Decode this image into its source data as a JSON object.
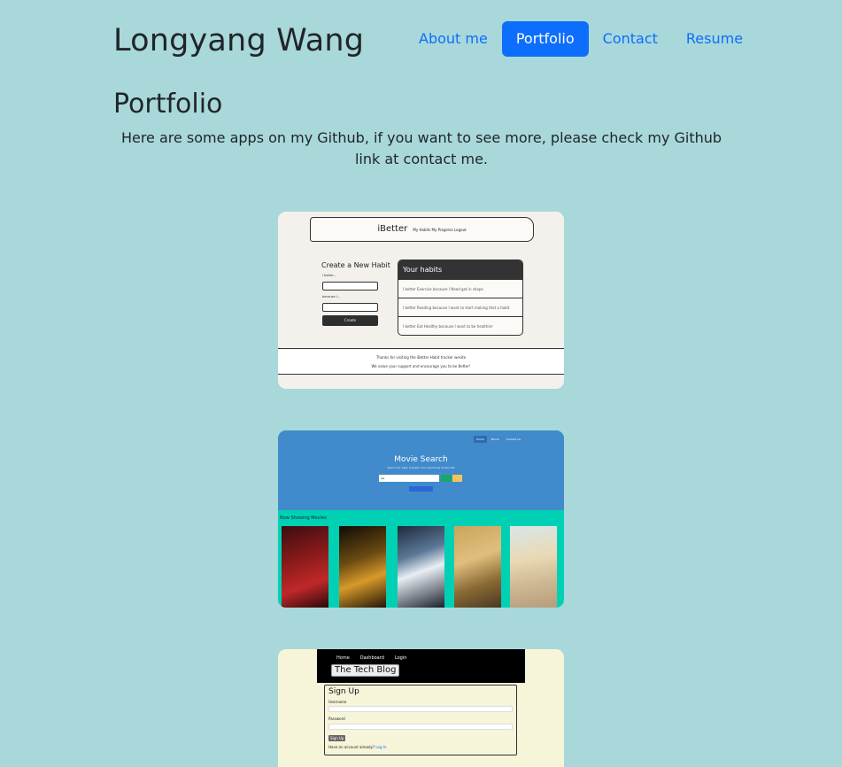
{
  "header": {
    "site_title": "Longyang Wang",
    "nav": [
      {
        "label": "About me",
        "active": false
      },
      {
        "label": "Portfolio",
        "active": true
      },
      {
        "label": "Contact",
        "active": false
      },
      {
        "label": "Resume",
        "active": false
      }
    ]
  },
  "main": {
    "heading": "Portfolio",
    "intro": "Here are some apps on my Github, if you want to see more, please check my Github link at contact me."
  },
  "projects": [
    {
      "name": "iBetter",
      "nav": "My Habits  My Progress  Logout",
      "create_title": "Create a New Habit",
      "label_better": "I better...",
      "label_because": "because I...",
      "create_button": "Create",
      "habits_title": "Your habits",
      "habits": [
        "I better Exercise because I Need get in shape",
        "I better Reading because I want to start making that a habit",
        "I better Eat Healthy because I want to be healthier"
      ],
      "footer_line1": "Thanks for visiting the iBetter Habit tracker wesite",
      "footer_line2": "We value your support and encourage you to be Better!"
    },
    {
      "name": "Movie Search",
      "nav": [
        "Home",
        "Movie",
        "Contact Us"
      ],
      "subtitle": "Search for past, present, and upcoming movie info",
      "input_value": "spi",
      "section_title": "Now Showing Movies"
    },
    {
      "name": "The Tech Blog",
      "nav": [
        "Home",
        "Dashboard",
        "Login"
      ],
      "form_title": "Sign Up",
      "username_label": "Username",
      "password_label": "Password",
      "submit_label": "Sign Up",
      "note": "Have an account already?",
      "note_link": "Log In"
    }
  ]
}
